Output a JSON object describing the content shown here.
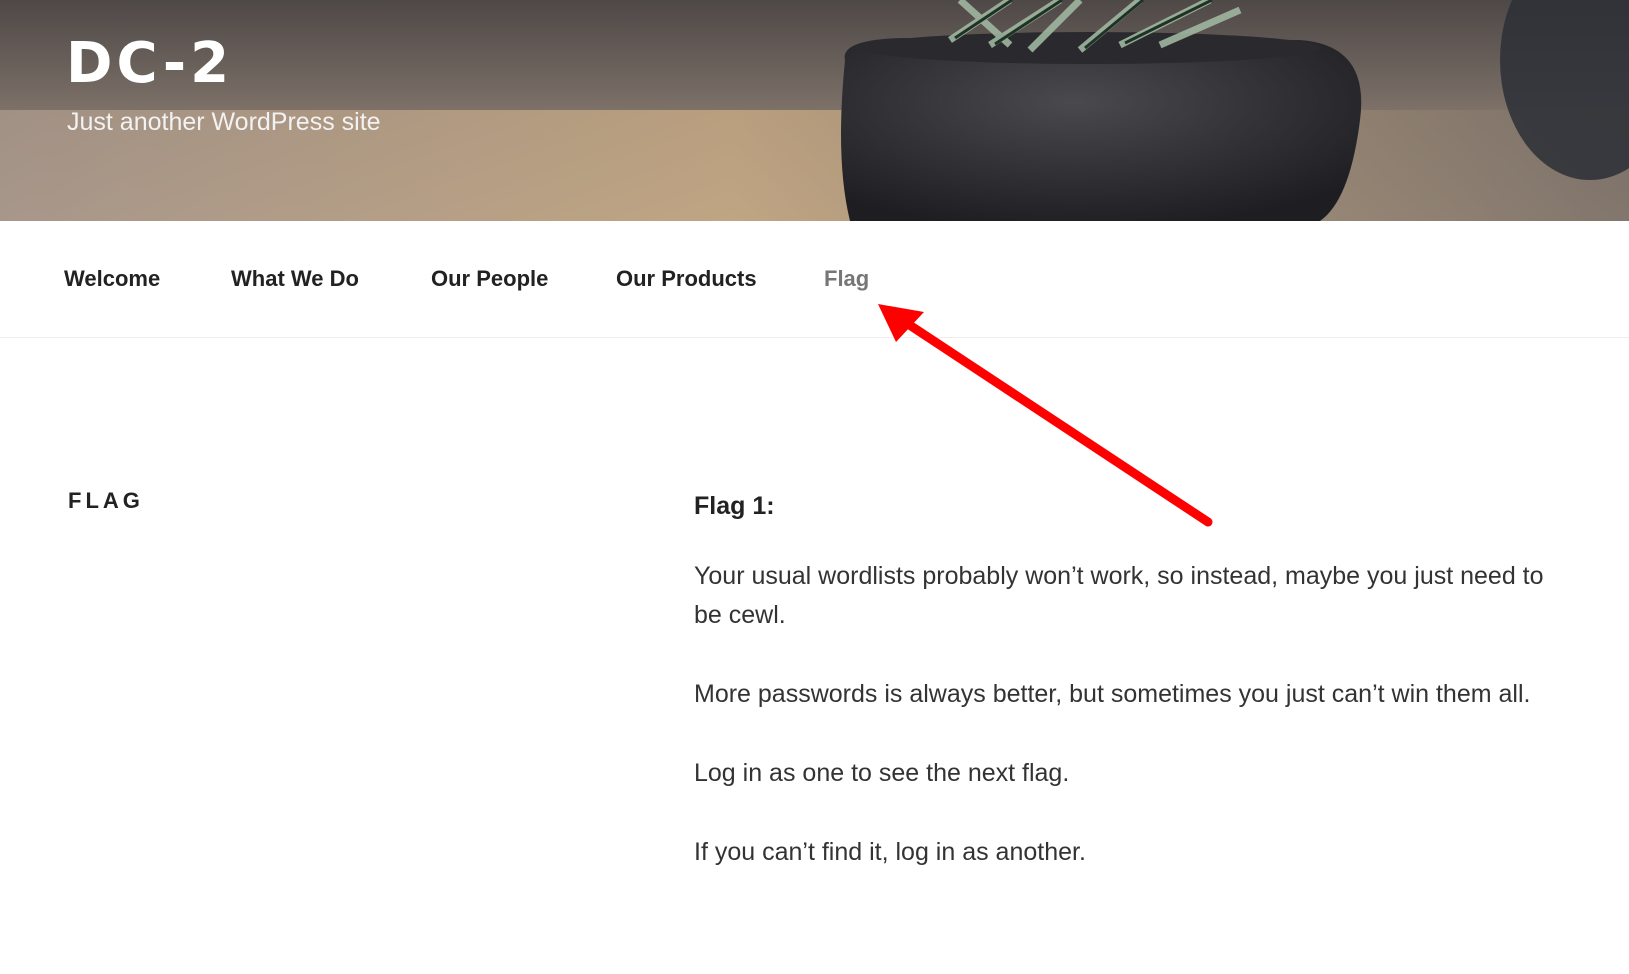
{
  "site": {
    "title": "DC-2",
    "description": "Just another WordPress site"
  },
  "nav": {
    "items": [
      {
        "label": "Welcome",
        "current": false
      },
      {
        "label": "What We Do",
        "current": false
      },
      {
        "label": "Our People",
        "current": false
      },
      {
        "label": "Our Products",
        "current": false
      },
      {
        "label": "Flag",
        "current": true
      }
    ]
  },
  "page": {
    "title": "FLAG",
    "heading": "Flag 1:",
    "paragraphs": [
      "Your usual wordlists probably won’t work, so instead, maybe you just need to be cewl.",
      "More passwords is always better, but sometimes you just can’t win them all.",
      "Log in as one to see the next flag.",
      "If you can’t find it, log in as another."
    ]
  },
  "colors": {
    "annotation_arrow": "#ff0000",
    "nav_text": "#222222",
    "nav_current": "#767676"
  }
}
